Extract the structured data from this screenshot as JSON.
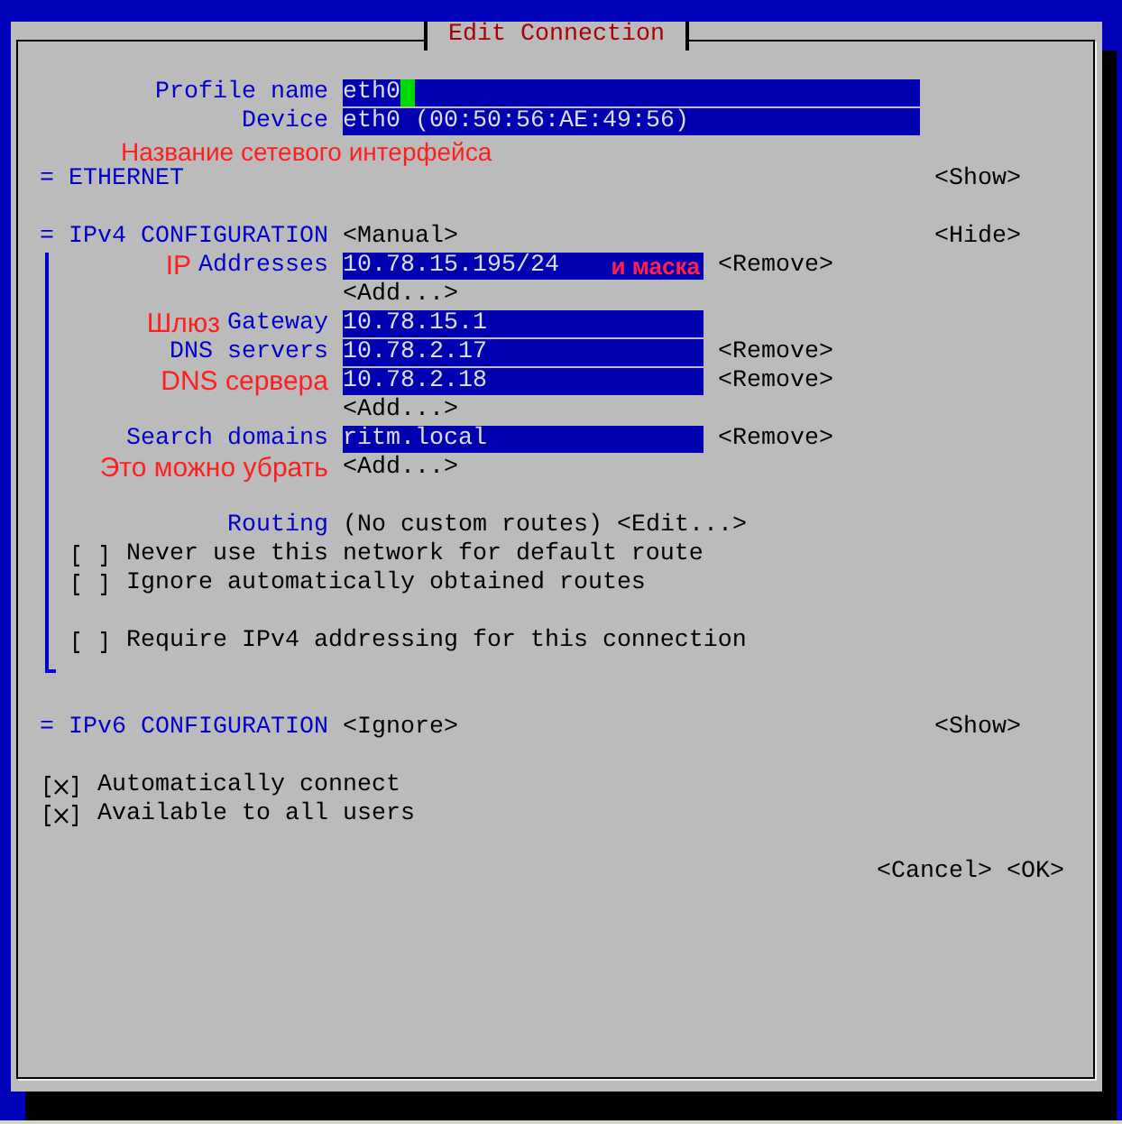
{
  "dialog": {
    "title": "Edit Connection"
  },
  "general": [
    {
      "kind": "field",
      "label": "Profile name",
      "value": "eth0",
      "focused": true
    },
    {
      "kind": "field",
      "label": "Device",
      "value": "eth0 (00:50:56:AE:49:56)",
      "focused": false
    },
    {
      "kind": "note",
      "text": "Название сетевого интерфейса"
    }
  ],
  "sections": [
    {
      "title": "= ETHERNET",
      "toggle": "<Show>",
      "expanded": false
    },
    {
      "title": "= IPv4 CONFIGURATION",
      "mode": "<Manual>",
      "toggle": "<Hide>",
      "expanded": true,
      "groups": [
        [
          {
            "kind": "field",
            "annotation": "IP",
            "label": "Addresses",
            "value": "10.78.15.195/24",
            "field_note": "и маска",
            "action": "<Remove>"
          },
          {
            "kind": "add",
            "action": "<Add...>"
          },
          {
            "kind": "field",
            "annotation": "Шлюз",
            "label": "Gateway",
            "value": "10.78.15.1"
          },
          {
            "kind": "field",
            "label": "DNS servers",
            "value": "10.78.2.17",
            "action": "<Remove>"
          },
          {
            "kind": "field",
            "annotation": "DNS сервера",
            "value": "10.78.2.18",
            "action": "<Remove>"
          },
          {
            "kind": "add",
            "action": "<Add...>"
          },
          {
            "kind": "field",
            "label": "Search domains",
            "value": "ritm.local",
            "action": "<Remove>"
          },
          {
            "kind": "add",
            "annotation": "Это можно убрать",
            "action": "<Add...>"
          }
        ],
        [
          {
            "kind": "routing",
            "label": "Routing",
            "value": "(No custom routes)",
            "action": "<Edit...>"
          },
          {
            "kind": "check",
            "label": "Never use this network for default route",
            "checked": false
          },
          {
            "kind": "check",
            "label": "Ignore automatically obtained routes",
            "checked": false
          }
        ],
        [
          {
            "kind": "check",
            "label": "Require IPv4 addressing for this connection",
            "checked": false
          }
        ]
      ]
    },
    {
      "title": "= IPv6 CONFIGURATION",
      "mode": "<Ignore>",
      "toggle": "<Show>",
      "expanded": false
    }
  ],
  "options": [
    {
      "label": "Automatically connect",
      "checked": true
    },
    {
      "label": "Available to all users",
      "checked": true
    }
  ],
  "buttons": [
    "<Cancel>",
    "<OK>"
  ]
}
